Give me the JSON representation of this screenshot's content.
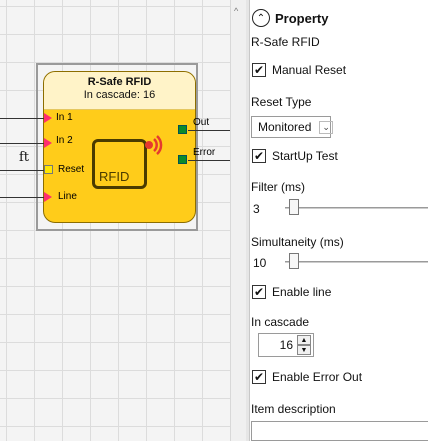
{
  "block": {
    "title": "R-Safe RFID",
    "subtitle": "In cascade: 16",
    "inputs": [
      "In 1",
      "In 2",
      "Reset",
      "Line"
    ],
    "outputs": [
      "Out",
      "Error"
    ],
    "logo_text": "RFID",
    "ft_symbol": "ft"
  },
  "panel": {
    "title": "Property",
    "item_name": "R-Safe RFID",
    "manual_reset": {
      "label": "Manual Reset",
      "checked": true
    },
    "reset_type": {
      "label": "Reset Type",
      "value": "Monitored"
    },
    "startup_test": {
      "label": "StartUp Test",
      "checked": true
    },
    "filter": {
      "label": "Filter (ms)",
      "value": "3"
    },
    "simultaneity": {
      "label": "Simultaneity (ms)",
      "value": "10"
    },
    "enable_line": {
      "label": "Enable line",
      "checked": true
    },
    "in_cascade": {
      "label": "In cascade",
      "value": "16"
    },
    "enable_error_out": {
      "label": "Enable Error Out",
      "checked": true
    },
    "item_description": {
      "label": "Item description",
      "value": ""
    }
  },
  "colors": {
    "block_fill": "#ffcc1a",
    "input_arrow": "#ff2e6e",
    "output_port": "#0c8a2a",
    "reset_port": "#ffe600"
  }
}
